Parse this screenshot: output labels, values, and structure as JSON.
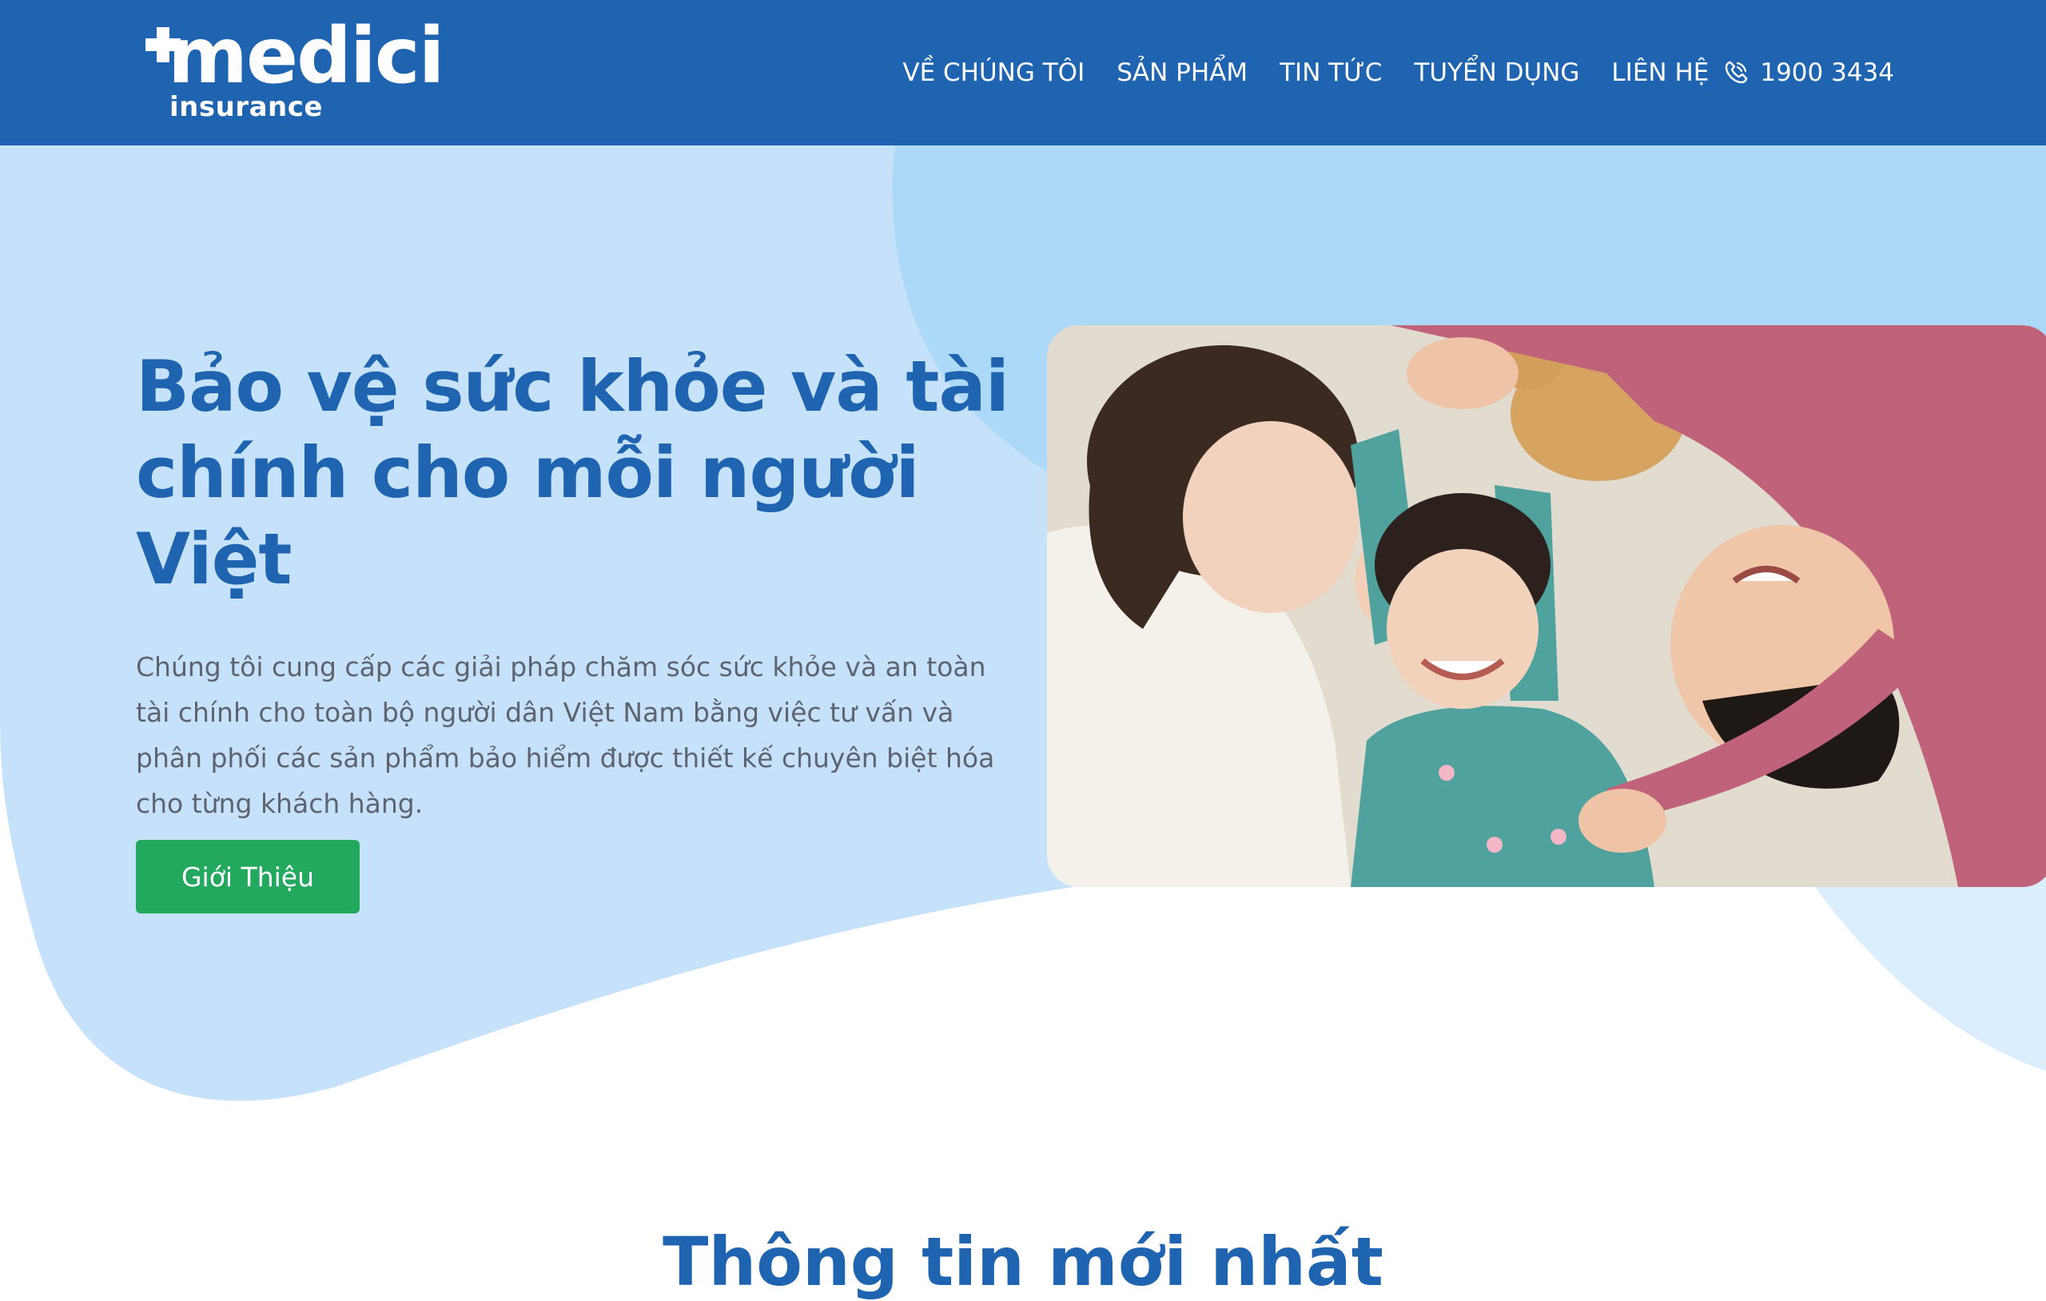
{
  "header": {
    "logo_text": "medici",
    "logo_subtext": "insurance",
    "nav": [
      "VỀ CHÚNG TÔI",
      "SẢN PHẨM",
      "TIN TỨC",
      "TUYỂN DỤNG",
      "LIÊN HỆ"
    ],
    "phone": "1900 3434",
    "phone_icon": "phone-icon",
    "bg_color": "#1f64b0"
  },
  "hero": {
    "title": "Bảo vệ sức khỏe và tài chính cho mỗi người Việt",
    "description": "Chúng tôi cung cấp các giải pháp chăm sóc sức khỏe và an toàn tài chính cho toàn bộ người dân Việt Nam bằng việc tư vấn và phân phối các sản phẩm bảo hiểm được thiết kế chuyên biệt hóa cho từng khách hàng.",
    "button_label": "Giới Thiệu",
    "button_color": "#22a95e",
    "title_color": "#1f64b0"
  },
  "section": {
    "title": "Thông tin mới nhất"
  }
}
